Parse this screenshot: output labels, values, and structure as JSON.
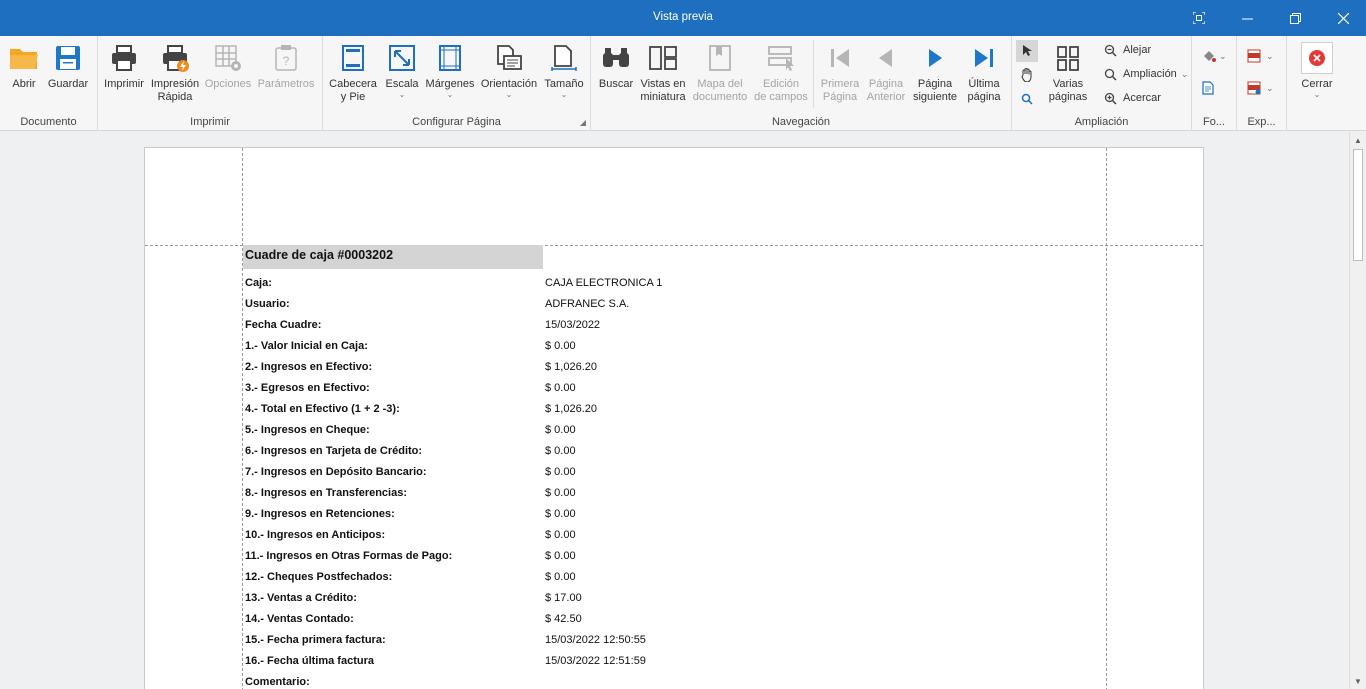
{
  "window": {
    "title": "Vista previa",
    "accent": "#1e6fc0",
    "controls": {
      "focus": "⛶",
      "minimize": "—",
      "restore": "❐",
      "close": "✕"
    }
  },
  "ribbon": {
    "documento": {
      "label": "Documento",
      "abrir": "Abrir",
      "guardar": "Guardar"
    },
    "imprimir": {
      "label": "Imprimir",
      "imprimir": "Imprimir",
      "impresion_rapida_1": "Impresión",
      "impresion_rapida_2": "Rápida",
      "opciones": "Opciones",
      "parametros": "Parámetros"
    },
    "configurar": {
      "label": "Configurar Página",
      "cabecera_1": "Cabecera",
      "cabecera_2": "y Pie",
      "escala": "Escala",
      "margenes": "Márgenes",
      "orientacion": "Orientación",
      "tamano": "Tamaño"
    },
    "navegacion": {
      "label": "Navegación",
      "buscar": "Buscar",
      "vistas_1": "Vistas en",
      "vistas_2": "miniatura",
      "mapa_1": "Mapa del",
      "mapa_2": "documento",
      "edicion_1": "Edición",
      "edicion_2": "de campos",
      "primera_1": "Primera",
      "primera_2": "Página",
      "anterior_1": "Página",
      "anterior_2": "Anterior",
      "siguiente_1": "Página",
      "siguiente_2": "siguiente",
      "ultima_1": "Última",
      "ultima_2": "página"
    },
    "ampliacion": {
      "label": "Ampliación",
      "varias_1": "Varias",
      "varias_2": "páginas",
      "alejar": "Alejar",
      "ampliacion": "Ampliación",
      "acercar": "Acercar"
    },
    "fondo": {
      "label": "Fo..."
    },
    "exportar": {
      "label": "Exp..."
    },
    "cerrar": {
      "label": "Cerrar"
    }
  },
  "report": {
    "title": "Cuadre de caja #0003202",
    "rows": [
      {
        "label": "Caja:",
        "value": "CAJA ELECTRONICA 1"
      },
      {
        "label": "Usuario:",
        "value": "ADFRANEC S.A."
      },
      {
        "label": "Fecha Cuadre:",
        "value": "15/03/2022"
      },
      {
        "label": "1.- Valor Inicial en Caja:",
        "value": "$ 0.00"
      },
      {
        "label": "2.- Ingresos en Efectivo:",
        "value": "$ 1,026.20"
      },
      {
        "label": "3.- Egresos en Efectivo:",
        "value": "$ 0.00"
      },
      {
        "label": "4.- Total en Efectivo (1 + 2 -3):",
        "value": "$ 1,026.20"
      },
      {
        "label": "5.- Ingresos en Cheque:",
        "value": "$ 0.00"
      },
      {
        "label": "6.- Ingresos en Tarjeta de Crédito:",
        "value": "$ 0.00"
      },
      {
        "label": "7.- Ingresos en Depósito Bancario:",
        "value": "$ 0.00"
      },
      {
        "label": "8.- Ingresos en Transferencias:",
        "value": "$ 0.00"
      },
      {
        "label": "9.- Ingresos en Retenciones:",
        "value": "$ 0.00"
      },
      {
        "label": "10.- Ingresos en Anticipos:",
        "value": "$ 0.00"
      },
      {
        "label": "11.- Ingresos en Otras Formas de Pago:",
        "value": "$ 0.00"
      },
      {
        "label": "12.- Cheques Postfechados:",
        "value": "$ 0.00"
      },
      {
        "label": "13.- Ventas a Crédito:",
        "value": "$ 17.00"
      },
      {
        "label": "14.- Ventas Contado:",
        "value": "$ 42.50"
      },
      {
        "label": "15.- Fecha primera factura:",
        "value": "15/03/2022 12:50:55"
      },
      {
        "label": "16.- Fecha última factura",
        "value": "15/03/2022 12:51:59"
      },
      {
        "label": "Comentario:",
        "value": ""
      }
    ]
  }
}
